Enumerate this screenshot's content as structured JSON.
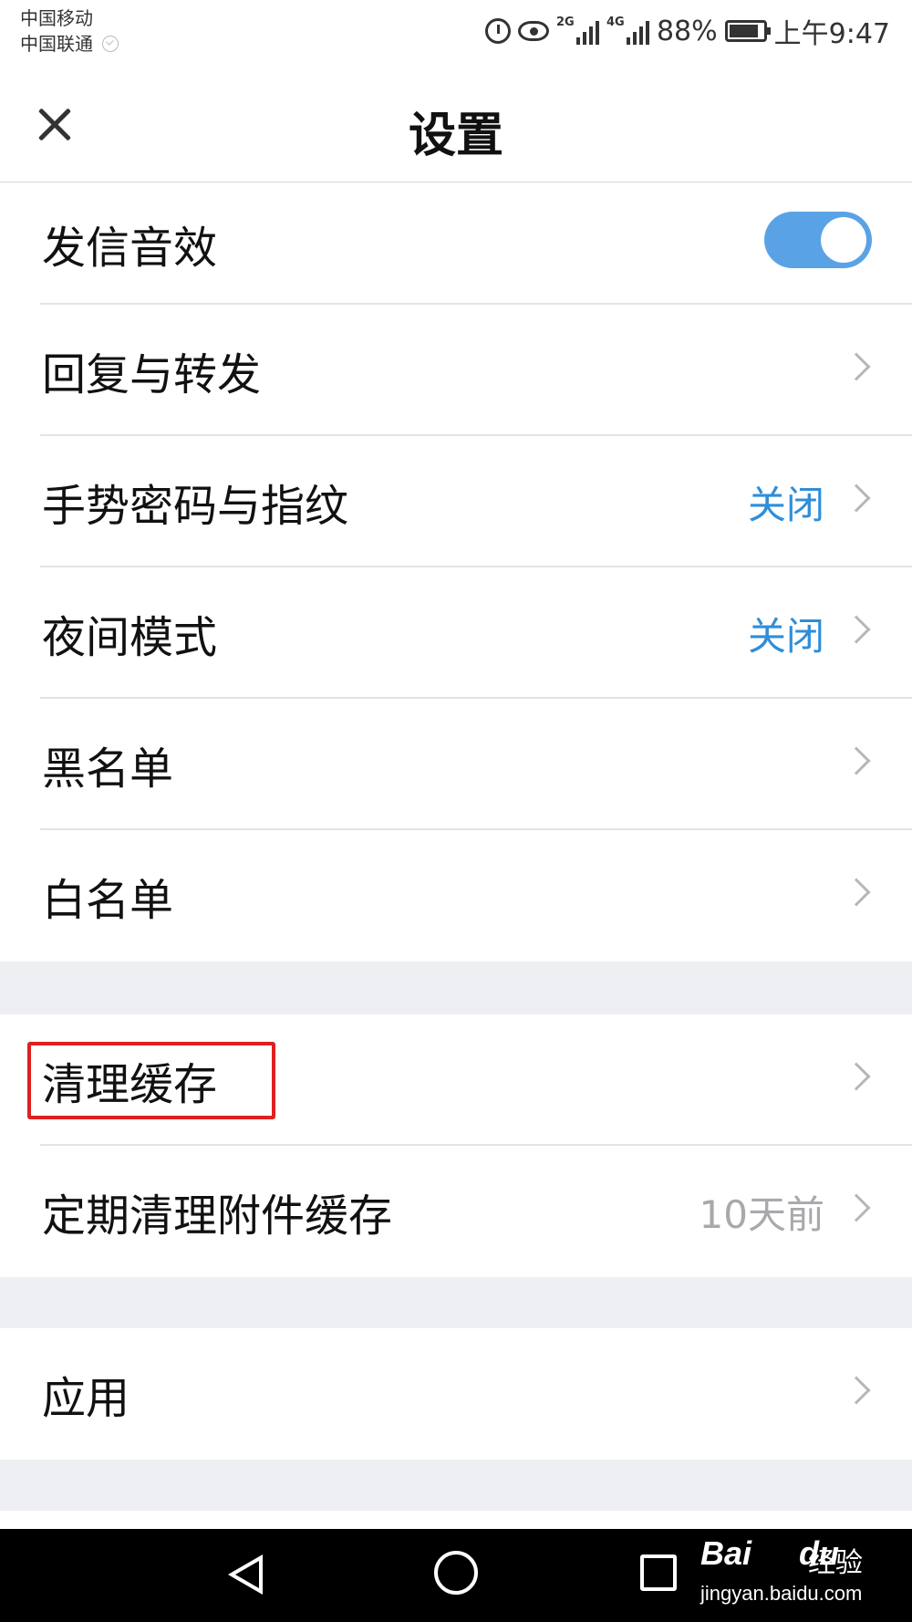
{
  "status_bar": {
    "carrier_1": "中国移动",
    "carrier_2": "中国联通",
    "network_1": "2G",
    "network_2": "4G",
    "battery": "88%",
    "time": "上午9:47"
  },
  "header": {
    "title": "设置",
    "close_icon": "close-icon"
  },
  "settings": {
    "group_1": [
      {
        "label": "发信音效",
        "type": "toggle",
        "on": true
      },
      {
        "label": "回复与转发",
        "type": "link"
      },
      {
        "label": "手势密码与指纹",
        "type": "link",
        "value": "关闭"
      },
      {
        "label": "夜间模式",
        "type": "link",
        "value": "关闭"
      },
      {
        "label": "黑名单",
        "type": "link"
      },
      {
        "label": "白名单",
        "type": "link"
      }
    ],
    "group_2": [
      {
        "label": "清理缓存",
        "type": "link"
      },
      {
        "label": "定期清理附件缓存",
        "type": "link",
        "value": "10天前"
      }
    ],
    "group_3": [
      {
        "label": "应用",
        "type": "link"
      }
    ]
  },
  "colors": {
    "accent": "#5aa2e6",
    "value_blue": "#2f8ed8",
    "highlight": "#e02020"
  },
  "nav_bar": {
    "icons": [
      "back-icon",
      "home-icon",
      "recents-icon"
    ]
  },
  "watermark": {
    "logo": "Bai",
    "logo_suffix": "du",
    "subtitle": "经验",
    "url": "jingyan.baidu.com"
  }
}
